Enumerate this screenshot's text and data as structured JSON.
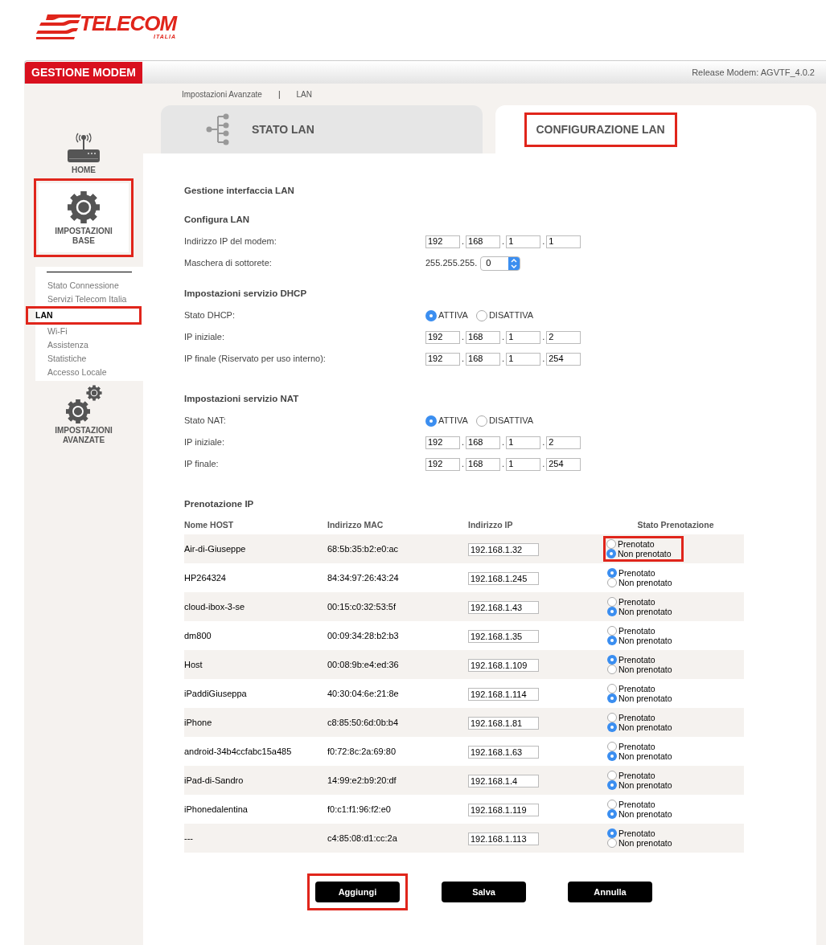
{
  "logo": {
    "name": "TELECOM",
    "sub": "ITALIA"
  },
  "header": {
    "tab": "GESTIONE MODEM",
    "release": "Release Modem: AGVTF_4.0.2"
  },
  "breadcrumb": {
    "items": [
      "Impostazioni Avanzate",
      "LAN"
    ],
    "separator": "|"
  },
  "tabs": [
    {
      "label": "STATO LAN",
      "selected": false,
      "highlighted": false
    },
    {
      "label": "CONFIGURAZIONE LAN",
      "selected": true,
      "highlighted": true
    }
  ],
  "sidebar": [
    {
      "kind": "home",
      "label": "HOME",
      "selected": false,
      "highlighted": false
    },
    {
      "kind": "gear",
      "label": "IMPOSTAZIONI BASE",
      "selected": true,
      "highlighted": true,
      "children": [
        {
          "label": "Stato Connessione",
          "selected": false,
          "highlighted": false
        },
        {
          "label": "Servizi Telecom Italia",
          "selected": false,
          "highlighted": false
        },
        {
          "label": "LAN",
          "selected": true,
          "highlighted": true
        },
        {
          "label": "Wi-Fi",
          "selected": false,
          "highlighted": false
        },
        {
          "label": "Assistenza",
          "selected": false,
          "highlighted": false
        },
        {
          "label": "Statistiche",
          "selected": false,
          "highlighted": false
        },
        {
          "label": "Accesso Locale",
          "selected": false,
          "highlighted": false
        }
      ]
    },
    {
      "kind": "gears",
      "label": "IMPOSTAZIONI AVANZATE",
      "selected": false,
      "highlighted": false
    }
  ],
  "page_title": "Gestione interfaccia LAN",
  "sections": [
    {
      "title": "Configura LAN",
      "rows": [
        {
          "kind": "ip",
          "label": "Indirizzo IP del modem:",
          "octets": [
            "192",
            "168",
            "1",
            "1"
          ],
          "separator": "."
        },
        {
          "kind": "mask",
          "label": "Maschera di sottorete:",
          "prefix": "255.255.255.",
          "value": "0"
        }
      ]
    },
    {
      "title": "Impostazioni servizio DHCP",
      "rows": [
        {
          "kind": "radio",
          "label": "Stato DHCP:",
          "options": [
            {
              "label": "ATTIVA",
              "selected": true
            },
            {
              "label": "DISATTIVA",
              "selected": false
            }
          ]
        },
        {
          "kind": "ip",
          "label": "IP iniziale:",
          "octets": [
            "192",
            "168",
            "1",
            "2"
          ],
          "separator": "."
        },
        {
          "kind": "ip",
          "label": "IP finale (Riservato per uso interno):",
          "octets": [
            "192",
            "168",
            "1",
            "254"
          ],
          "separator": "."
        }
      ]
    },
    {
      "title": "Impostazioni servizio NAT",
      "rows": [
        {
          "kind": "radio",
          "label": "Stato NAT:",
          "options": [
            {
              "label": "ATTIVA",
              "selected": true
            },
            {
              "label": "DISATTIVA",
              "selected": false
            }
          ]
        },
        {
          "kind": "ip",
          "label": "IP iniziale:",
          "octets": [
            "192",
            "168",
            "1",
            "2"
          ],
          "separator": "."
        },
        {
          "kind": "ip",
          "label": "IP finale:",
          "octets": [
            "192",
            "168",
            "1",
            "254"
          ],
          "separator": "."
        }
      ]
    }
  ],
  "reservation": {
    "title": "Prenotazione IP",
    "columns": [
      "Nome HOST",
      "Indirizzo MAC",
      "Indirizzo IP",
      "Stato Prenotazione"
    ],
    "rows": [
      {
        "host": "Air-di-Giuseppe",
        "mac": "68:5b:35:b2:e0:ac",
        "ip": "192.168.1.32",
        "highlighted": true,
        "options": [
          {
            "label": "Prenotato",
            "selected": false
          },
          {
            "label": "Non prenotato",
            "selected": true
          }
        ]
      },
      {
        "host": "HP264324",
        "mac": "84:34:97:26:43:24",
        "ip": "192.168.1.245",
        "highlighted": false,
        "options": [
          {
            "label": "Prenotato",
            "selected": true
          },
          {
            "label": "Non prenotato",
            "selected": false
          }
        ]
      },
      {
        "host": "cloud-ibox-3-se",
        "mac": "00:15:c0:32:53:5f",
        "ip": "192.168.1.43",
        "highlighted": false,
        "options": [
          {
            "label": "Prenotato",
            "selected": false
          },
          {
            "label": "Non prenotato",
            "selected": true
          }
        ]
      },
      {
        "host": "dm800",
        "mac": "00:09:34:28:b2:b3",
        "ip": "192.168.1.35",
        "highlighted": false,
        "options": [
          {
            "label": "Prenotato",
            "selected": false
          },
          {
            "label": "Non prenotato",
            "selected": true
          }
        ]
      },
      {
        "host": "Host",
        "mac": "00:08:9b:e4:ed:36",
        "ip": "192.168.1.109",
        "highlighted": false,
        "options": [
          {
            "label": "Prenotato",
            "selected": true
          },
          {
            "label": "Non prenotato",
            "selected": false
          }
        ]
      },
      {
        "host": "iPaddiGiuseppa",
        "mac": "40:30:04:6e:21:8e",
        "ip": "192.168.1.114",
        "highlighted": false,
        "options": [
          {
            "label": "Prenotato",
            "selected": false
          },
          {
            "label": "Non prenotato",
            "selected": true
          }
        ]
      },
      {
        "host": "iPhone",
        "mac": "c8:85:50:6d:0b:b4",
        "ip": "192.168.1.81",
        "highlighted": false,
        "options": [
          {
            "label": "Prenotato",
            "selected": false
          },
          {
            "label": "Non prenotato",
            "selected": true
          }
        ]
      },
      {
        "host": "android-34b4ccfabc15a485",
        "mac": "f0:72:8c:2a:69:80",
        "ip": "192.168.1.63",
        "highlighted": false,
        "options": [
          {
            "label": "Prenotato",
            "selected": false
          },
          {
            "label": "Non prenotato",
            "selected": true
          }
        ]
      },
      {
        "host": "iPad-di-Sandro",
        "mac": "14:99:e2:b9:20:df",
        "ip": "192.168.1.4",
        "highlighted": false,
        "options": [
          {
            "label": "Prenotato",
            "selected": false
          },
          {
            "label": "Non prenotato",
            "selected": true
          }
        ]
      },
      {
        "host": "iPhonedalentina",
        "mac": "f0:c1:f1:96:f2:e0",
        "ip": "192.168.1.119",
        "highlighted": false,
        "options": [
          {
            "label": "Prenotato",
            "selected": false
          },
          {
            "label": "Non prenotato",
            "selected": true
          }
        ]
      },
      {
        "host": "---",
        "mac": "c4:85:08:d1:cc:2a",
        "ip": "192.168.1.113",
        "highlighted": false,
        "options": [
          {
            "label": "Prenotato",
            "selected": true
          },
          {
            "label": "Non prenotato",
            "selected": false
          }
        ]
      }
    ]
  },
  "buttons": [
    {
      "label": "Aggiungi",
      "highlighted": true
    },
    {
      "label": "Salva",
      "highlighted": false
    },
    {
      "label": "Annulla",
      "highlighted": false
    }
  ]
}
